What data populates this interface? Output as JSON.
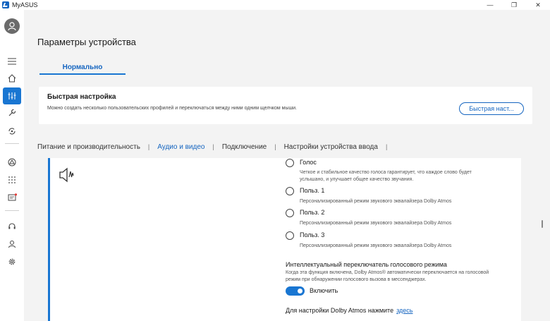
{
  "titlebar": {
    "app_title": "MyASUS",
    "minimize": "—",
    "maximize": "❐",
    "close": "✕"
  },
  "sidebar": {
    "items": [
      {
        "name": "menu",
        "icon": "hamburger-icon"
      },
      {
        "name": "home",
        "icon": "home-icon"
      },
      {
        "name": "device-settings",
        "icon": "sliders-icon",
        "active": true
      },
      {
        "name": "diagnostics",
        "icon": "wrench-icon"
      },
      {
        "name": "link-to-myasus",
        "icon": "sync-icon"
      },
      {
        "name": "linked-devices",
        "icon": "triangle-nodes-icon"
      },
      {
        "name": "apps",
        "icon": "grid-icon"
      },
      {
        "name": "news",
        "icon": "message-icon"
      },
      {
        "name": "support",
        "icon": "headset-icon"
      },
      {
        "name": "account",
        "icon": "person-icon"
      },
      {
        "name": "settings",
        "icon": "gear-icon"
      }
    ]
  },
  "main": {
    "title": "Параметры устройства",
    "mode_tab": "Нормально",
    "quick_setup": {
      "title": "Быстрая настройка",
      "description": "Можно создать несколько пользовательских профилей и переключаться между ними одним щелчком мыши.",
      "button": "Быстрая наст..."
    },
    "tabs": [
      {
        "label": "Питание и производительность",
        "active": false
      },
      {
        "label": "Аудио и видео",
        "active": true
      },
      {
        "label": "Подключение",
        "active": false
      },
      {
        "label": "Настройки устройства ввода",
        "active": false
      }
    ],
    "audio": {
      "options": [
        {
          "label": "Голос",
          "desc_lines": [
            "Четкое и стабильное качество голоса гарантирует, что каждое слово будет",
            "услышано, и улучшает общее качество звучания."
          ]
        },
        {
          "label": "Польз. 1",
          "desc_lines": [
            "Персонализированный режим звукового эквалайзера Dolby Atmos"
          ]
        },
        {
          "label": "Польз. 2",
          "desc_lines": [
            "Персонализированный режим звукового эквалайзера Dolby Atmos"
          ]
        },
        {
          "label": "Польз. 3",
          "desc_lines": [
            "Персонализированный режим звукового эквалайзера Dolby Atmos"
          ]
        }
      ],
      "smart_switch": {
        "title": "Интеллектуальный переключатель голосового режима",
        "description": "Когда эта функция включена, Dolby Atmos® автоматически переключается на голосовой режим при обнаружении голосового вызова в мессенджерах.",
        "toggle_label": "Включить",
        "enabled": true
      },
      "dolby_text": "Для настройки Dolby Atmos нажмите",
      "dolby_link": "здесь"
    }
  },
  "colors": {
    "accent": "#1976d2",
    "link": "#1565c0",
    "background": "#f3f3f3",
    "card": "#ffffff"
  }
}
